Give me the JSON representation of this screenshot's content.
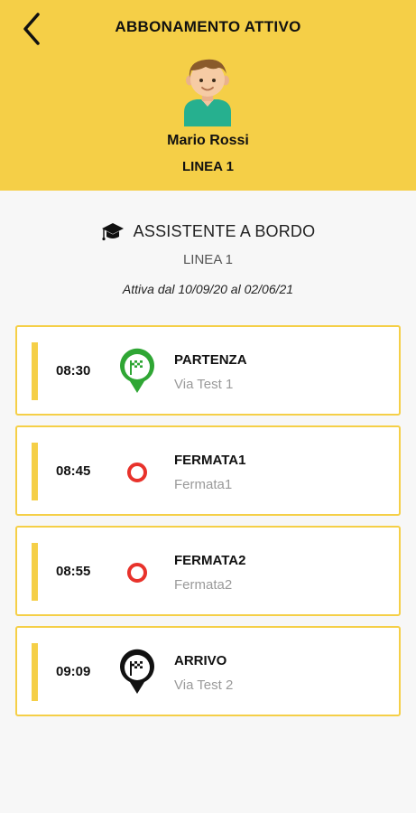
{
  "header": {
    "title": "ABBONAMENTO ATTIVO",
    "user_name": "Mario Rossi",
    "line": "LINEA 1",
    "back_icon": "chevron-left-icon",
    "bg_color": "#f5cf47"
  },
  "subscription": {
    "role": "ASSISTENTE A BORDO",
    "role_icon": "graduation-cap-icon",
    "line": "LINEA 1",
    "validity": "Attiva dal 10/09/20 al 02/06/21"
  },
  "stops": [
    {
      "time": "08:30",
      "name": "PARTENZA",
      "address": "Via Test 1",
      "icon": "start-flag-pin-icon",
      "color": "#2fa634"
    },
    {
      "time": "08:45",
      "name": "FERMATA1",
      "address": "Fermata1",
      "icon": "stop-circle-icon",
      "color": "#e8322b"
    },
    {
      "time": "08:55",
      "name": "FERMATA2",
      "address": "Fermata2",
      "icon": "stop-circle-icon",
      "color": "#e8322b"
    },
    {
      "time": "09:09",
      "name": "ARRIVO",
      "address": "Via Test 2",
      "icon": "finish-flag-pin-icon",
      "color": "#111111"
    }
  ]
}
